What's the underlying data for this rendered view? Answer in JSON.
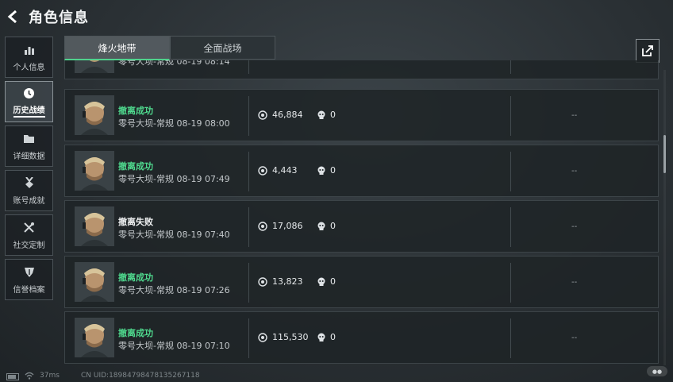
{
  "header": {
    "title": "角色信息"
  },
  "sidebar": {
    "items": [
      {
        "label": "个人信息",
        "icon": "bar-chart-icon",
        "active": false
      },
      {
        "label": "历史战绩",
        "icon": "clock-icon",
        "active": true
      },
      {
        "label": "详细数据",
        "icon": "folder-icon",
        "active": false
      },
      {
        "label": "账号成就",
        "icon": "medal-icon",
        "active": false
      },
      {
        "label": "社交定制",
        "icon": "tools-icon",
        "active": false
      },
      {
        "label": "信誉档案",
        "icon": "shield-icon",
        "active": false
      }
    ]
  },
  "tabs": [
    {
      "label": "烽火地带",
      "active": true
    },
    {
      "label": "全面战场",
      "active": false
    }
  ],
  "partial_row": {
    "map_line": "零号大坝-常规 08-19 08:14"
  },
  "matches": [
    {
      "status": "撤离成功",
      "result": "success",
      "map": "零号大坝-常规",
      "time": "08-19 08:00",
      "value": "46,884",
      "kills": "0",
      "extra": "--"
    },
    {
      "status": "撤离成功",
      "result": "success",
      "map": "零号大坝-常规",
      "time": "08-19 07:49",
      "value": "4,443",
      "kills": "0",
      "extra": "--"
    },
    {
      "status": "撤离失败",
      "result": "fail",
      "map": "零号大坝-常规",
      "time": "08-19 07:40",
      "value": "17,086",
      "kills": "0",
      "extra": "--"
    },
    {
      "status": "撤离成功",
      "result": "success",
      "map": "零号大坝-常规",
      "time": "08-19 07:26",
      "value": "13,823",
      "kills": "0",
      "extra": "--"
    },
    {
      "status": "撤离成功",
      "result": "success",
      "map": "零号大坝-常规",
      "time": "08-19 07:10",
      "value": "115,530",
      "kills": "0",
      "extra": "--"
    }
  ],
  "statusbar": {
    "ping": "37ms",
    "uid": "CN UID:18984798478135267118"
  },
  "colors": {
    "success": "#4fd98e",
    "fail": "#f0f2f3",
    "tab_underline": "#50d28d"
  }
}
